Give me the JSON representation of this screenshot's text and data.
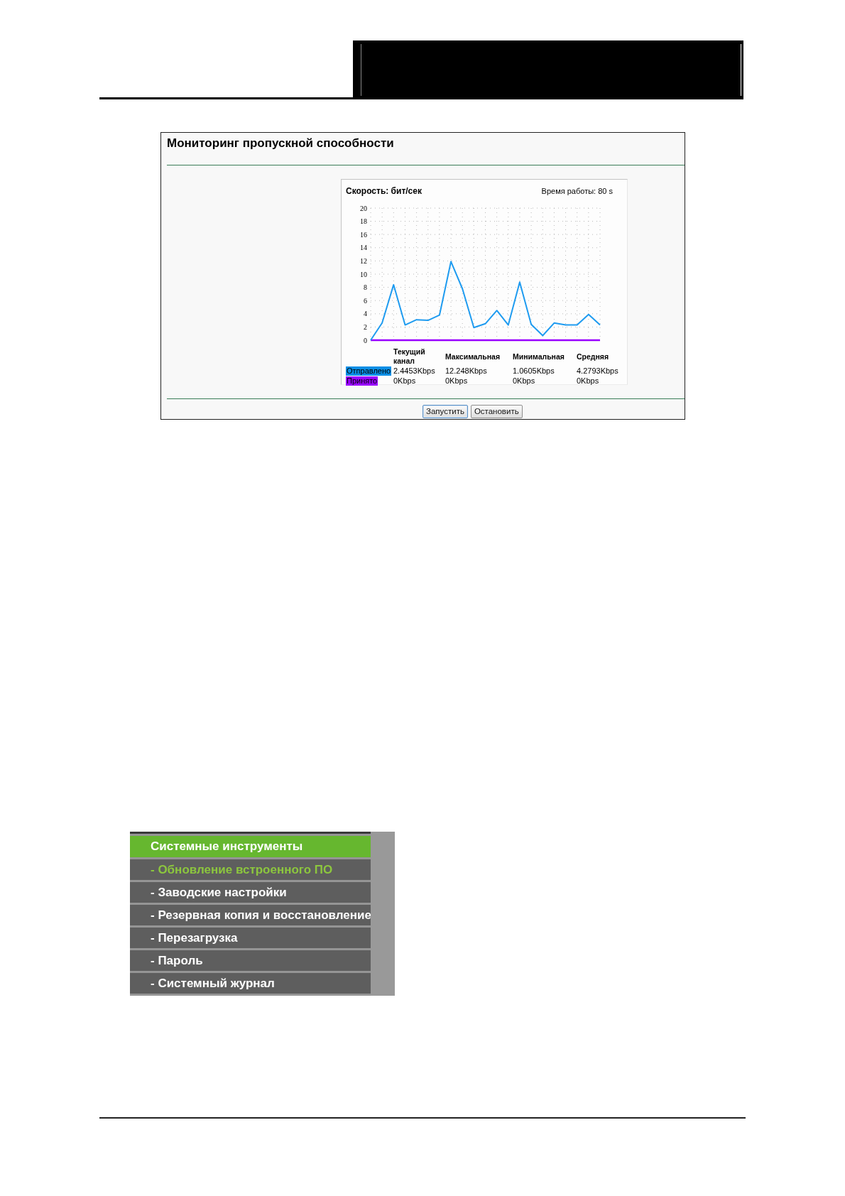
{
  "panel": {
    "title": "Мониторинг пропускной способности",
    "chart": {
      "uptime": "Время работы: 80 s",
      "chart_data": {
        "type": "line",
        "title": "Скорость: бит/сек",
        "grid": true,
        "ylim": [
          0,
          20
        ],
        "yticks": [
          0,
          2,
          4,
          6,
          8,
          10,
          12,
          14,
          16,
          18,
          20
        ],
        "series": [
          {
            "color": "#1e9bf0",
            "values": [
              0,
              2.6,
              8.4,
              2.3,
              3.1,
              3.0,
              3.8,
              11.9,
              7.8,
              1.9,
              2.5,
              4.5,
              2.3,
              8.8,
              2.4,
              0.7,
              2.6,
              2.3,
              2.3,
              3.9,
              2.3
            ]
          },
          {
            "color": "#9900ff",
            "values": [
              0,
              0,
              0,
              0,
              0,
              0,
              0,
              0,
              0,
              0,
              0,
              0,
              0,
              0,
              0,
              0,
              0,
              0,
              0,
              0,
              0
            ]
          }
        ]
      },
      "stats": {
        "columns": [
          "Текущий канал",
          "Максимальная",
          "Минимальная",
          "Средняя"
        ],
        "rows": [
          {
            "label": "Отправлено",
            "color": "#0a8fe6",
            "values": [
              "2.4453Kbps",
              "12.248Kbps",
              "1.0605Kbps",
              "4.2793Kbps"
            ]
          },
          {
            "label": "Принято",
            "color": "#9900ff",
            "values": [
              "0Kbps",
              "0Kbps",
              "0Kbps",
              "0Kbps"
            ]
          }
        ]
      }
    },
    "buttons": [
      {
        "label": "Запустить",
        "focused": true
      },
      {
        "label": "Остановить",
        "focused": false
      }
    ]
  },
  "menu": {
    "title": "Системные инструменты",
    "items": [
      {
        "label": "- Обновление встроенного ПО",
        "selected": true
      },
      {
        "label": "- Заводские настройки",
        "selected": false
      },
      {
        "label": "- Резервная копия и восстановление",
        "selected": false
      },
      {
        "label": "- Перезагрузка",
        "selected": false
      },
      {
        "label": "- Пароль",
        "selected": false
      },
      {
        "label": "- Системный журнал",
        "selected": false
      }
    ]
  }
}
